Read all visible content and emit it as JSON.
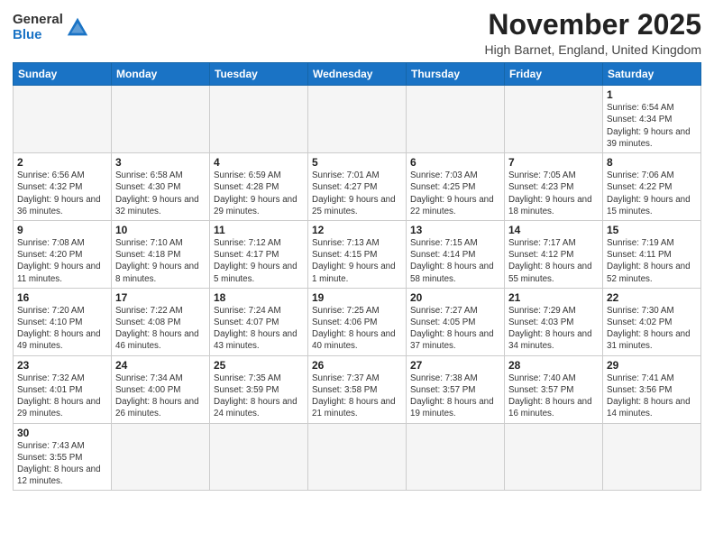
{
  "header": {
    "logo_line1": "General",
    "logo_line2": "Blue",
    "month_title": "November 2025",
    "subtitle": "High Barnet, England, United Kingdom"
  },
  "weekdays": [
    "Sunday",
    "Monday",
    "Tuesday",
    "Wednesday",
    "Thursday",
    "Friday",
    "Saturday"
  ],
  "weeks": [
    [
      {
        "day": "",
        "info": ""
      },
      {
        "day": "",
        "info": ""
      },
      {
        "day": "",
        "info": ""
      },
      {
        "day": "",
        "info": ""
      },
      {
        "day": "",
        "info": ""
      },
      {
        "day": "",
        "info": ""
      },
      {
        "day": "1",
        "info": "Sunrise: 6:54 AM\nSunset: 4:34 PM\nDaylight: 9 hours\nand 39 minutes."
      }
    ],
    [
      {
        "day": "2",
        "info": "Sunrise: 6:56 AM\nSunset: 4:32 PM\nDaylight: 9 hours\nand 36 minutes."
      },
      {
        "day": "3",
        "info": "Sunrise: 6:58 AM\nSunset: 4:30 PM\nDaylight: 9 hours\nand 32 minutes."
      },
      {
        "day": "4",
        "info": "Sunrise: 6:59 AM\nSunset: 4:28 PM\nDaylight: 9 hours\nand 29 minutes."
      },
      {
        "day": "5",
        "info": "Sunrise: 7:01 AM\nSunset: 4:27 PM\nDaylight: 9 hours\nand 25 minutes."
      },
      {
        "day": "6",
        "info": "Sunrise: 7:03 AM\nSunset: 4:25 PM\nDaylight: 9 hours\nand 22 minutes."
      },
      {
        "day": "7",
        "info": "Sunrise: 7:05 AM\nSunset: 4:23 PM\nDaylight: 9 hours\nand 18 minutes."
      },
      {
        "day": "8",
        "info": "Sunrise: 7:06 AM\nSunset: 4:22 PM\nDaylight: 9 hours\nand 15 minutes."
      }
    ],
    [
      {
        "day": "9",
        "info": "Sunrise: 7:08 AM\nSunset: 4:20 PM\nDaylight: 9 hours\nand 11 minutes."
      },
      {
        "day": "10",
        "info": "Sunrise: 7:10 AM\nSunset: 4:18 PM\nDaylight: 9 hours\nand 8 minutes."
      },
      {
        "day": "11",
        "info": "Sunrise: 7:12 AM\nSunset: 4:17 PM\nDaylight: 9 hours\nand 5 minutes."
      },
      {
        "day": "12",
        "info": "Sunrise: 7:13 AM\nSunset: 4:15 PM\nDaylight: 9 hours\nand 1 minute."
      },
      {
        "day": "13",
        "info": "Sunrise: 7:15 AM\nSunset: 4:14 PM\nDaylight: 8 hours\nand 58 minutes."
      },
      {
        "day": "14",
        "info": "Sunrise: 7:17 AM\nSunset: 4:12 PM\nDaylight: 8 hours\nand 55 minutes."
      },
      {
        "day": "15",
        "info": "Sunrise: 7:19 AM\nSunset: 4:11 PM\nDaylight: 8 hours\nand 52 minutes."
      }
    ],
    [
      {
        "day": "16",
        "info": "Sunrise: 7:20 AM\nSunset: 4:10 PM\nDaylight: 8 hours\nand 49 minutes."
      },
      {
        "day": "17",
        "info": "Sunrise: 7:22 AM\nSunset: 4:08 PM\nDaylight: 8 hours\nand 46 minutes."
      },
      {
        "day": "18",
        "info": "Sunrise: 7:24 AM\nSunset: 4:07 PM\nDaylight: 8 hours\nand 43 minutes."
      },
      {
        "day": "19",
        "info": "Sunrise: 7:25 AM\nSunset: 4:06 PM\nDaylight: 8 hours\nand 40 minutes."
      },
      {
        "day": "20",
        "info": "Sunrise: 7:27 AM\nSunset: 4:05 PM\nDaylight: 8 hours\nand 37 minutes."
      },
      {
        "day": "21",
        "info": "Sunrise: 7:29 AM\nSunset: 4:03 PM\nDaylight: 8 hours\nand 34 minutes."
      },
      {
        "day": "22",
        "info": "Sunrise: 7:30 AM\nSunset: 4:02 PM\nDaylight: 8 hours\nand 31 minutes."
      }
    ],
    [
      {
        "day": "23",
        "info": "Sunrise: 7:32 AM\nSunset: 4:01 PM\nDaylight: 8 hours\nand 29 minutes."
      },
      {
        "day": "24",
        "info": "Sunrise: 7:34 AM\nSunset: 4:00 PM\nDaylight: 8 hours\nand 26 minutes."
      },
      {
        "day": "25",
        "info": "Sunrise: 7:35 AM\nSunset: 3:59 PM\nDaylight: 8 hours\nand 24 minutes."
      },
      {
        "day": "26",
        "info": "Sunrise: 7:37 AM\nSunset: 3:58 PM\nDaylight: 8 hours\nand 21 minutes."
      },
      {
        "day": "27",
        "info": "Sunrise: 7:38 AM\nSunset: 3:57 PM\nDaylight: 8 hours\nand 19 minutes."
      },
      {
        "day": "28",
        "info": "Sunrise: 7:40 AM\nSunset: 3:57 PM\nDaylight: 8 hours\nand 16 minutes."
      },
      {
        "day": "29",
        "info": "Sunrise: 7:41 AM\nSunset: 3:56 PM\nDaylight: 8 hours\nand 14 minutes."
      }
    ],
    [
      {
        "day": "30",
        "info": "Sunrise: 7:43 AM\nSunset: 3:55 PM\nDaylight: 8 hours\nand 12 minutes."
      },
      {
        "day": "",
        "info": ""
      },
      {
        "day": "",
        "info": ""
      },
      {
        "day": "",
        "info": ""
      },
      {
        "day": "",
        "info": ""
      },
      {
        "day": "",
        "info": ""
      },
      {
        "day": "",
        "info": ""
      }
    ]
  ]
}
